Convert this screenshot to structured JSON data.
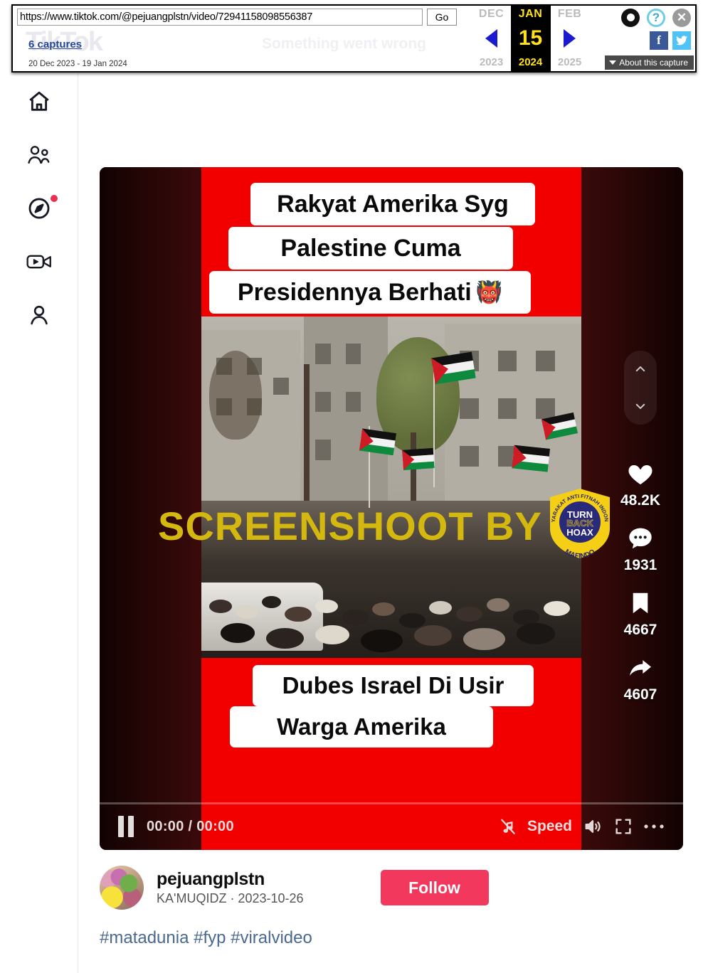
{
  "wayback": {
    "url": "https://www.tiktok.com/@pejuangplstn/video/72941158098556387",
    "go_label": "Go",
    "captures_label": "6 captures",
    "range_label": "20 Dec 2023 - 19 Jan 2024",
    "ghost_logo": "TikTok",
    "ghost_message": "Something went wrong",
    "about_label": "About this capture",
    "months": {
      "prev": {
        "name": "DEC",
        "year": "2023"
      },
      "current": {
        "name": "JAN",
        "day": "15",
        "year": "2024"
      },
      "next": {
        "name": "FEB",
        "year": "2025"
      }
    },
    "icons": {
      "account": "account-icon",
      "help": "?",
      "close": "✕",
      "facebook": "f",
      "twitter": "twitter-bird-icon"
    }
  },
  "sidebar": {
    "items": [
      {
        "name": "home-icon",
        "has_dot": false
      },
      {
        "name": "friends-icon",
        "has_dot": false
      },
      {
        "name": "explore-compass-icon",
        "has_dot": true
      },
      {
        "name": "live-video-icon",
        "has_dot": false
      },
      {
        "name": "profile-person-icon",
        "has_dot": false
      }
    ]
  },
  "video": {
    "overlay_top": [
      "Rakyat Amerika Syg",
      "Palestine Cuma",
      "Presidennya Berhati"
    ],
    "overlay_top_emoji": "👹",
    "overlay_bottom": [
      "Dubes Israel Di Usir",
      "Warga Amerika"
    ],
    "watermark_text": "SCREENSHOOT BY",
    "watermark_color": "#d4b810",
    "badge": {
      "arc_top": "MASYARAKAT ANTI FITNAH INDONESIA",
      "line1": "TURN",
      "line2": "BACK",
      "line3": "HOAX",
      "bottom": "MAFINDO",
      "shield_color": "#f5cf16",
      "circle_color": "#2a2a7a"
    },
    "scene": "protest-crowd-with-palestinian-flags"
  },
  "actions": [
    {
      "name": "like-button",
      "icon": "heart-icon",
      "count": "48.2K"
    },
    {
      "name": "comment-button",
      "icon": "comment-bubble-icon",
      "count": "1931"
    },
    {
      "name": "bookmark-button",
      "icon": "bookmark-icon",
      "count": "4667"
    },
    {
      "name": "share-button",
      "icon": "share-arrow-icon",
      "count": "4607"
    }
  ],
  "controls": {
    "pause": "pause-icon",
    "timecode": "00:00 / 00:00",
    "music_off": "music-note-off-icon",
    "speed_label": "Speed",
    "volume": "volume-on-icon",
    "fullscreen": "fullscreen-icon",
    "more": "more-options-icon",
    "progress_percent": 0
  },
  "author": {
    "name": "pejuangplstn",
    "subtitle": "KA'MUQIDZ · 2023-10-26",
    "follow_label": "Follow",
    "follow_color": "#f2385c"
  },
  "caption": {
    "hashtags": "#matadunia #fyp #viralvideo",
    "link_color": "#4a6990"
  }
}
